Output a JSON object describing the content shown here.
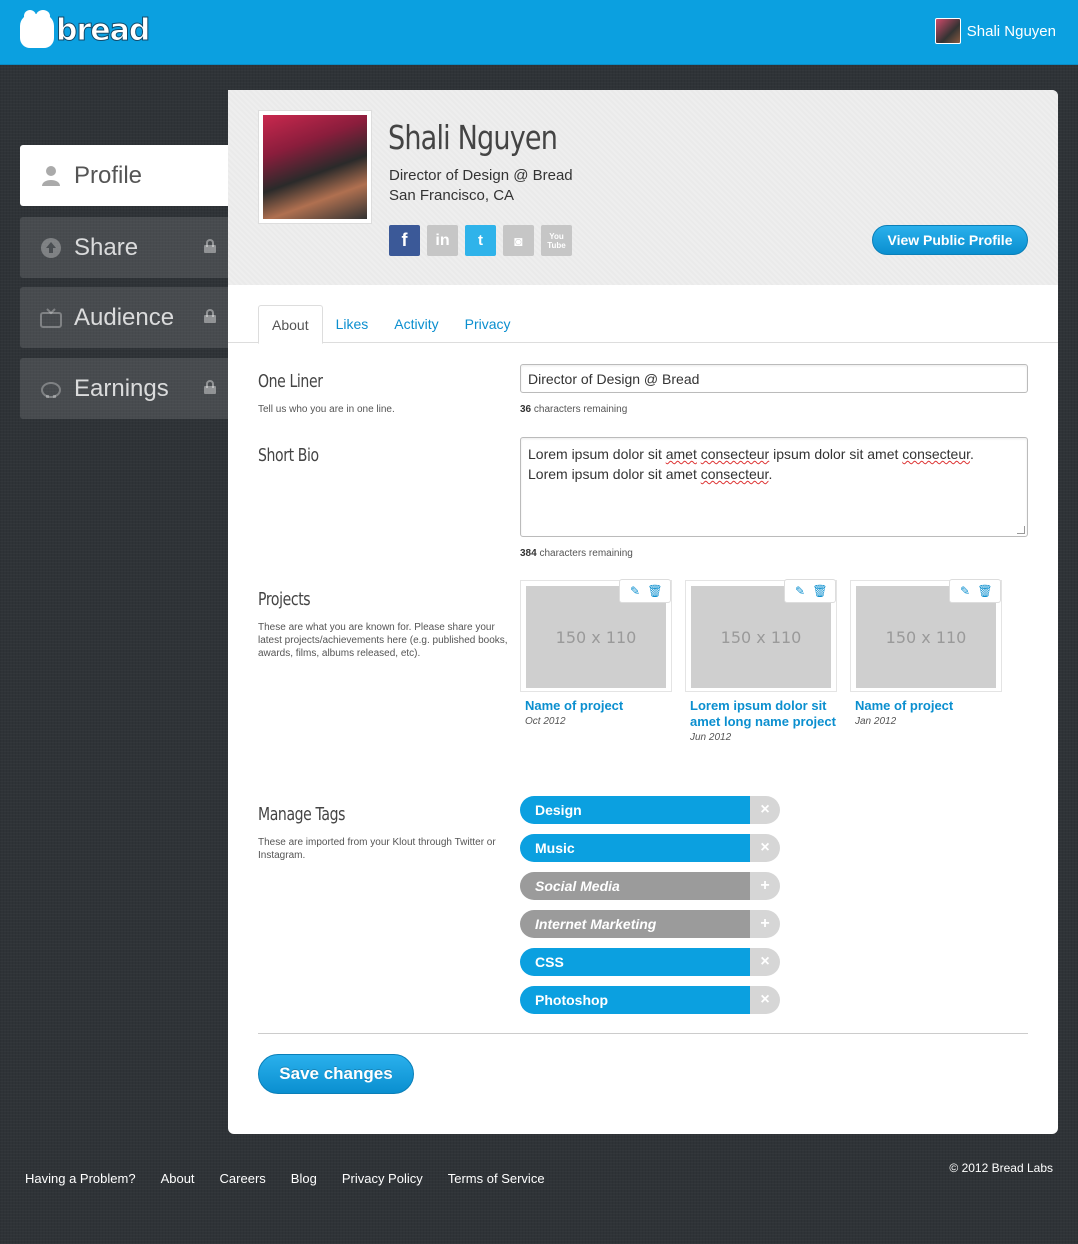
{
  "header": {
    "logo_text": "bread",
    "user_name": "Shali Nguyen"
  },
  "sidebar": {
    "items": [
      {
        "label": "Profile",
        "icon": "person-icon",
        "locked": false,
        "active": true
      },
      {
        "label": "Share",
        "icon": "upload-icon",
        "locked": true,
        "active": false
      },
      {
        "label": "Audience",
        "icon": "tv-icon",
        "locked": true,
        "active": false
      },
      {
        "label": "Earnings",
        "icon": "piggy-bank-icon",
        "locked": true,
        "active": false
      }
    ]
  },
  "profile": {
    "name": "Shali Nguyen",
    "role": "Director of Design @ Bread",
    "location": "San Francisco, CA",
    "socials": [
      {
        "name": "facebook-icon",
        "glyph": "f",
        "color": "#3b5998"
      },
      {
        "name": "linkedin-icon",
        "glyph": "in",
        "color": "#c6c6c6"
      },
      {
        "name": "twitter-icon",
        "glyph": "t",
        "color": "#2fb3ea"
      },
      {
        "name": "instagram-icon",
        "glyph": "◙",
        "color": "#c6c6c6"
      },
      {
        "name": "youtube-icon",
        "glyph": "You Tube",
        "color": "#c6c6c6"
      }
    ],
    "view_button": "View Public Profile"
  },
  "tabs": [
    "About",
    "Likes",
    "Activity",
    "Privacy"
  ],
  "one_liner": {
    "title": "One Liner",
    "desc": "Tell us who you are in one line.",
    "value": "Director of Design @ Bread",
    "remaining_count": "36",
    "remaining_text": "characters remaining"
  },
  "short_bio": {
    "title": "Short Bio",
    "line1_a": "Lorem ipsum dolor sit ",
    "line1_b": "amet",
    "line1_c": " ",
    "line1_d": "consecteur",
    "line1_e": " ipsum dolor sit amet ",
    "line1_f": "consecteur",
    "line1_g": ".",
    "line2_a": "Lorem ipsum dolor sit amet ",
    "line2_b": "consecteur",
    "line2_c": ".",
    "remaining_count": "384",
    "remaining_text": "characters remaining"
  },
  "projects": {
    "title": "Projects",
    "desc": "These are what you are known for. Please share your latest projects/achievements here (e.g. published books, awards, films, albums released, etc).",
    "items": [
      {
        "placeholder": "150 x 110",
        "name": "Name of project",
        "date": "Oct 2012"
      },
      {
        "placeholder": "150 x 110",
        "name": "Lorem ipsum dolor sit amet long name project",
        "date": "Jun 2012"
      },
      {
        "placeholder": "150 x 110",
        "name": "Name of project",
        "date": "Jan 2012"
      }
    ]
  },
  "tags": {
    "title": "Manage Tags",
    "desc": "These are imported from your Klout through Twitter or Instagram.",
    "items": [
      {
        "label": "Design",
        "state": "added",
        "action": "×"
      },
      {
        "label": "Music",
        "state": "added",
        "action": "×"
      },
      {
        "label": "Social Media",
        "state": "suggested",
        "action": "+"
      },
      {
        "label": "Internet Marketing",
        "state": "suggested",
        "action": "+"
      },
      {
        "label": "CSS",
        "state": "added",
        "action": "×"
      },
      {
        "label": "Photoshop",
        "state": "added",
        "action": "×"
      }
    ]
  },
  "save_button": "Save changes",
  "footer": {
    "links": [
      "Having a Problem?",
      "About",
      "Careers",
      "Blog",
      "Privacy Policy",
      "Terms of Service"
    ],
    "copyright": "© 2012 Bread Labs"
  },
  "colors": {
    "brand": "#0ba0e0",
    "link": "#0b8fcf",
    "tag_suggested": "#9b9b9b"
  }
}
